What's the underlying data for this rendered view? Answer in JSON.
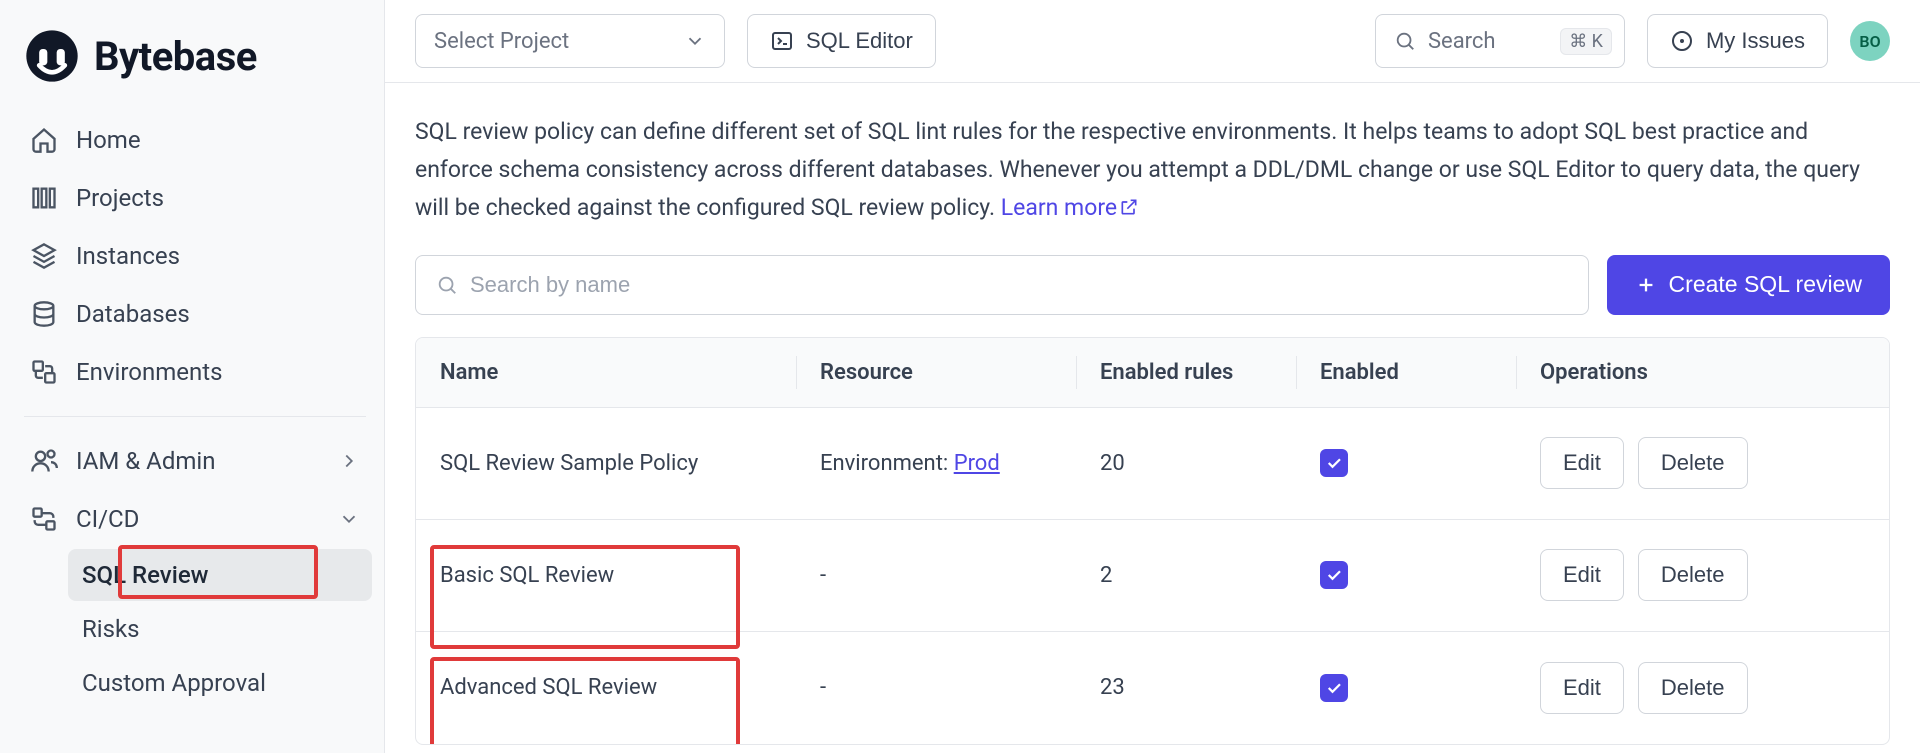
{
  "brand": {
    "name": "Bytebase"
  },
  "sidebar": {
    "items": [
      {
        "label": "Home"
      },
      {
        "label": "Projects"
      },
      {
        "label": "Instances"
      },
      {
        "label": "Databases"
      },
      {
        "label": "Environments"
      }
    ],
    "iam_label": "IAM & Admin",
    "cicd_label": "CI/CD",
    "sub": {
      "sql_review": "SQL Review",
      "risks": "Risks",
      "custom_approval": "Custom Approval"
    }
  },
  "topbar": {
    "select_project": "Select Project",
    "sql_editor": "SQL Editor",
    "search_placeholder": "Search",
    "search_kbd": "⌘ K",
    "my_issues": "My Issues",
    "avatar_initials": "BO"
  },
  "page": {
    "description_a": "SQL review policy can define different set of SQL lint rules for the respective environments. It helps teams to adopt SQL best practice and enforce schema consistency across different databases. Whenever you attempt a DDL/DML change or use SQL Editor to query data, the query will be checked against the configured SQL review policy. ",
    "learn_more": "Learn more",
    "search_placeholder": "Search by name",
    "create_label": "Create SQL review"
  },
  "table": {
    "headers": {
      "name": "Name",
      "resource": "Resource",
      "enabled_rules": "Enabled rules",
      "enabled": "Enabled",
      "operations": "Operations"
    },
    "edit_label": "Edit",
    "delete_label": "Delete",
    "rows": [
      {
        "name": "SQL Review Sample Policy",
        "resource_prefix": "Environment: ",
        "resource_link": "Prod",
        "enabled_rules": "20",
        "enabled": true
      },
      {
        "name": "Basic SQL Review",
        "resource_prefix": "-",
        "resource_link": "",
        "enabled_rules": "2",
        "enabled": true,
        "highlight": true
      },
      {
        "name": "Advanced SQL Review",
        "resource_prefix": "-",
        "resource_link": "",
        "enabled_rules": "23",
        "enabled": true,
        "highlight": true
      }
    ]
  }
}
